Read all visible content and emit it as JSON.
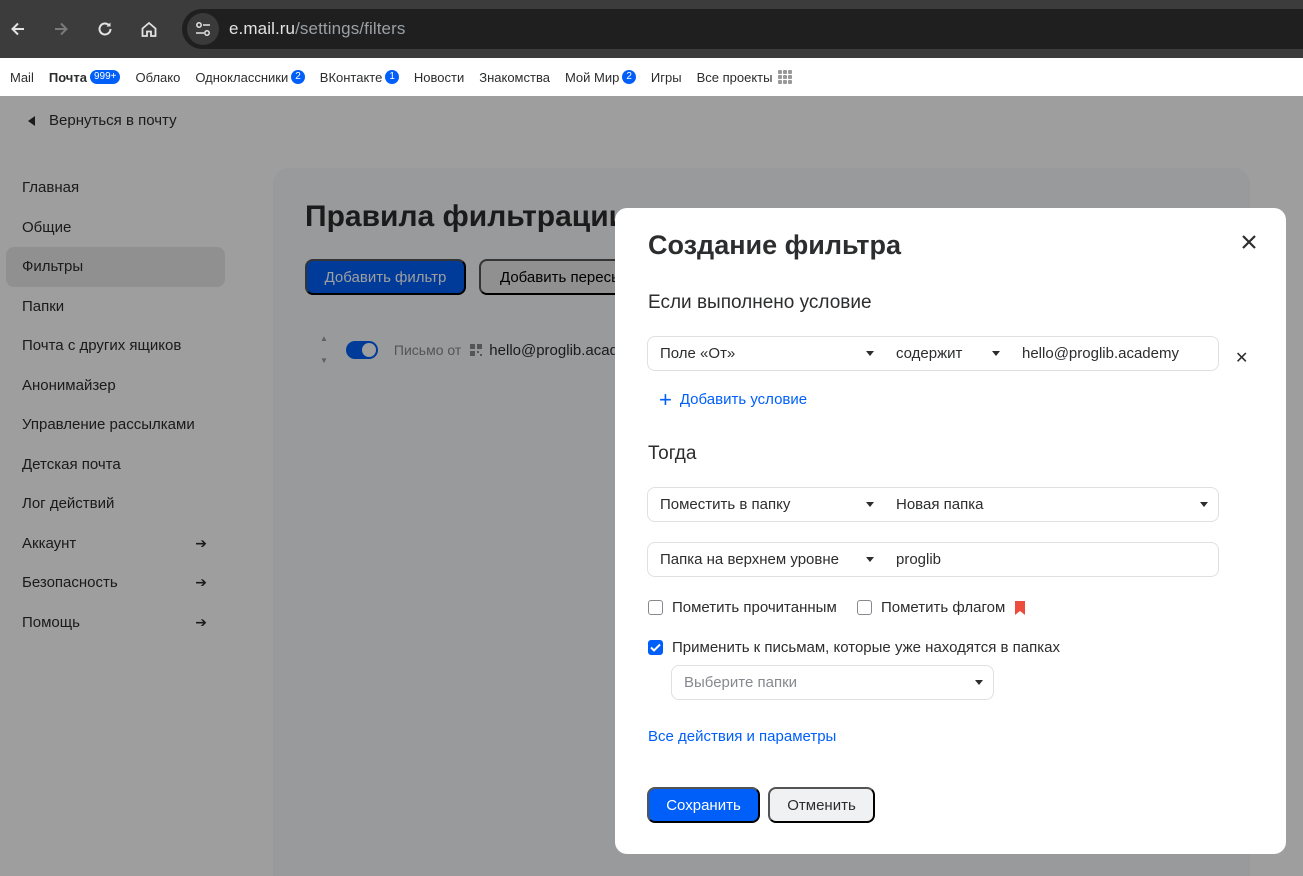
{
  "browser": {
    "url_host": "e.mail.ru",
    "url_path": "/settings/filters"
  },
  "portal": {
    "items": [
      {
        "label": "Mail"
      },
      {
        "label": "Почта",
        "badge": "999+"
      },
      {
        "label": "Облако"
      },
      {
        "label": "Одноклассники",
        "badge": "2"
      },
      {
        "label": "ВКонтакте",
        "badge": "1"
      },
      {
        "label": "Новости"
      },
      {
        "label": "Знакомства"
      },
      {
        "label": "Мой Мир",
        "badge": "2"
      },
      {
        "label": "Игры"
      },
      {
        "label": "Все проекты"
      }
    ]
  },
  "back_link": "Вернуться в почту",
  "sidebar": {
    "items": [
      {
        "label": "Главная"
      },
      {
        "label": "Общие"
      },
      {
        "label": "Фильтры"
      },
      {
        "label": "Папки"
      },
      {
        "label": "Почта с других ящиков"
      },
      {
        "label": "Анонимайзер"
      },
      {
        "label": "Управление рассылками"
      },
      {
        "label": "Детская почта"
      },
      {
        "label": "Лог действий"
      },
      {
        "label": "Аккаунт",
        "arrow": "➔"
      },
      {
        "label": "Безопасность",
        "arrow": "➔"
      },
      {
        "label": "Помощь",
        "arrow": "➔"
      }
    ]
  },
  "page": {
    "title": "Правила фильтрации",
    "add_filter": "Добавить фильтр",
    "add_forward": "Добавить пересылку",
    "rule": {
      "label": "Письмо от",
      "email": "hello@proglib.academy"
    }
  },
  "modal": {
    "title": "Создание фильтра",
    "condition_title": "Если выполнено условие",
    "condition": {
      "field": "Поле «От»",
      "operator": "содержит",
      "value": "hello@proglib.academy"
    },
    "add_condition": "Добавить условие",
    "then_title": "Тогда",
    "action": "Поместить в папку",
    "folder": "Новая папка",
    "folder_level": "Папка на верхнем уровне",
    "folder_name": "proglib",
    "mark_read": "Пометить прочитанным",
    "mark_flag": "Пометить флагом",
    "apply_existing": "Применить к письмам, которые уже находятся в папках",
    "choose_folders_placeholder": "Выберите папки",
    "all_actions": "Все действия и параметры",
    "save": "Сохранить",
    "cancel": "Отменить"
  },
  "colors": {
    "accent": "#005ff9",
    "flag": "#ed4d3d"
  }
}
